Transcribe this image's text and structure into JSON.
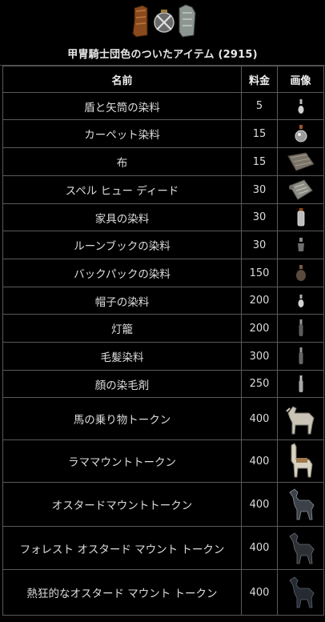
{
  "header": {
    "title": "甲冑騎士団色のついたアイテム (2915)"
  },
  "columns": {
    "name": "名前",
    "price": "料金",
    "image": "画像"
  },
  "items": [
    {
      "name": "盾と矢筒の染料",
      "price": "5",
      "icon": "small-dye-bottle-icon"
    },
    {
      "name": "カーペット染料",
      "price": "15",
      "icon": "dye-flask-icon"
    },
    {
      "name": "布",
      "price": "15",
      "icon": "cloth-roll-icon"
    },
    {
      "name": "スペル ヒュー ディード",
      "price": "30",
      "icon": "deed-scroll-icon"
    },
    {
      "name": "家具の染料",
      "price": "30",
      "icon": "dye-bottle-icon"
    },
    {
      "name": "ルーンブックの染料",
      "price": "30",
      "icon": "dye-vial-icon"
    },
    {
      "name": "バックパックの染料",
      "price": "150",
      "icon": "dye-pouch-icon"
    },
    {
      "name": "帽子の染料",
      "price": "200",
      "icon": "small-dye-bottle-icon"
    },
    {
      "name": "灯籠",
      "price": "200",
      "icon": "lantern-icon"
    },
    {
      "name": "毛髪染料",
      "price": "300",
      "icon": "hair-dye-icon"
    },
    {
      "name": "顔の染毛剤",
      "price": "250",
      "icon": "facial-dye-icon"
    },
    {
      "name": "馬の乗り物トークン",
      "price": "400",
      "icon": "horse-icon"
    },
    {
      "name": "ラママウントトークン",
      "price": "400",
      "icon": "llama-icon"
    },
    {
      "name": "オスタードマウントトークン",
      "price": "400",
      "icon": "ostard-icon"
    },
    {
      "name": "フォレスト オスタード マウント トークン",
      "price": "400",
      "icon": "forest-ostard-icon"
    },
    {
      "name": "熱狂的なオスタード マウント トークン",
      "price": "400",
      "icon": "frenzied-ostard-icon"
    }
  ]
}
